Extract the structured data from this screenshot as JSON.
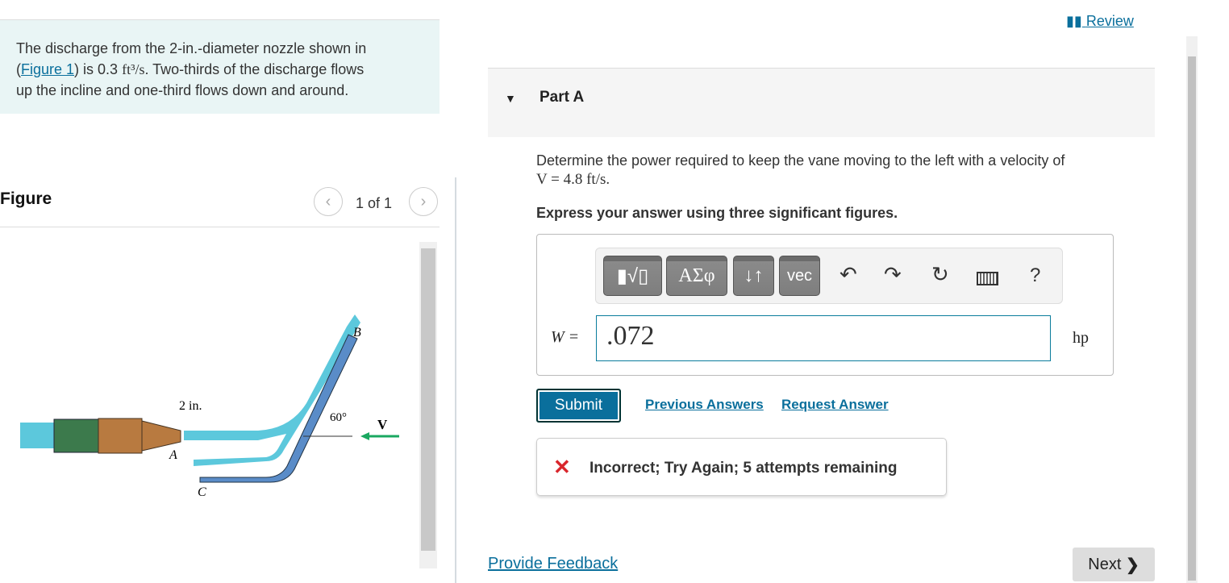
{
  "problem": {
    "text_1": "The discharge from the 2-in.-diameter nozzle shown in",
    "paren_open": "(",
    "figure_link": "Figure 1",
    "text_2": ") is 0.3 ",
    "unit_flow": "ft³/s",
    "text_3": ". Two-thirds of the discharge flows",
    "text_4": "up the incline and one-third flows down and around."
  },
  "figure": {
    "title": "Figure",
    "counter": "1 of 1",
    "prev_icon": "chevron-left-icon",
    "next_icon": "chevron-right-icon",
    "labels": {
      "diameter": "2 in.",
      "a": "A",
      "b": "B",
      "c": "C",
      "angle": "60°",
      "v": "V"
    },
    "colors": {
      "water": "#5cc8dc",
      "vane": "#5a8cc8",
      "hose": "#3c7a4c",
      "nozzle": "#b87a40",
      "arrow": "#1aa860"
    }
  },
  "review": {
    "label": "Review",
    "icon": "book-icon"
  },
  "part": {
    "label": "Part A",
    "toggle_icon": "caret-down-icon"
  },
  "question": {
    "line1": "Determine the power required to keep the vane moving to the left with a velocity of",
    "line2": "V = 4.8 ft/s.",
    "instruction": "Express your answer using three significant figures."
  },
  "toolbar": {
    "templates": "▮√▯",
    "greek": "ΑΣφ",
    "arrows": "↓↑",
    "vec": "vec",
    "undo_icon": "undo-icon",
    "redo_icon": "redo-icon",
    "reset_icon": "reset-icon",
    "keyboard_icon": "keyboard-icon",
    "help": "?"
  },
  "answer": {
    "label": "W =",
    "value": ".072",
    "unit": "hp"
  },
  "actions": {
    "submit": "Submit",
    "previous": "Previous Answers",
    "request": "Request Answer"
  },
  "feedback": {
    "icon": "x-icon",
    "text": "Incorrect; Try Again; 5 attempts remaining",
    "color": "#d9262c"
  },
  "footer": {
    "provide_feedback": "Provide Feedback",
    "next": "Next"
  }
}
